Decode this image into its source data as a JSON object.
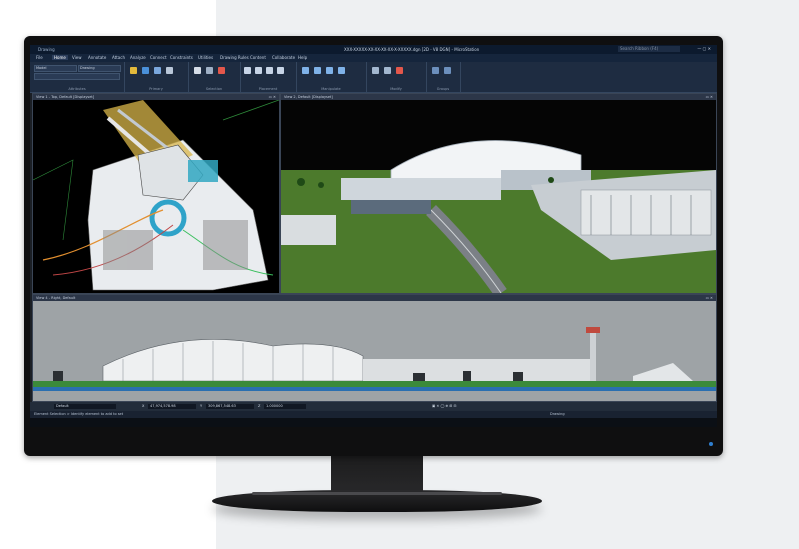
{
  "app": {
    "workflow": "Drawing",
    "title": "XXX-XXXXX-XX-XX-XX-XX-X-XXXXX.dgn [2D - V8 DGN] - MicroStation",
    "search_placeholder": "Search Ribbon (F4)"
  },
  "menu_tabs": [
    "File",
    "Home",
    "View",
    "Annotate",
    "Attach",
    "Analyze",
    "Connect",
    "Constraints",
    "Utilities",
    "Drawing Rules",
    "Content",
    "Collaborate",
    "Help"
  ],
  "active_tab_index": 1,
  "ribbon_groups": [
    "Attributes",
    "Primary",
    "Selection",
    "Placement",
    "Manipulate",
    "Modify",
    "Groups"
  ],
  "ribbon_fields": {
    "level": "Model",
    "style": "Drawing"
  },
  "views": {
    "view1_title": "View 1 - Top, Default [Displayset]",
    "view2_title": "View 2, Default [Displayset]",
    "view4_title": "View 4 - Right, Default"
  },
  "status": {
    "level_field": "Default",
    "x_label": "X",
    "x_value": "47,974,578.98",
    "y_label": "Y",
    "y_value": "309,867,548.63",
    "z_label": "Z",
    "z_value": "1.000000",
    "prompt": "Element Selection > Identify element to add to set",
    "model": "Drawing"
  }
}
